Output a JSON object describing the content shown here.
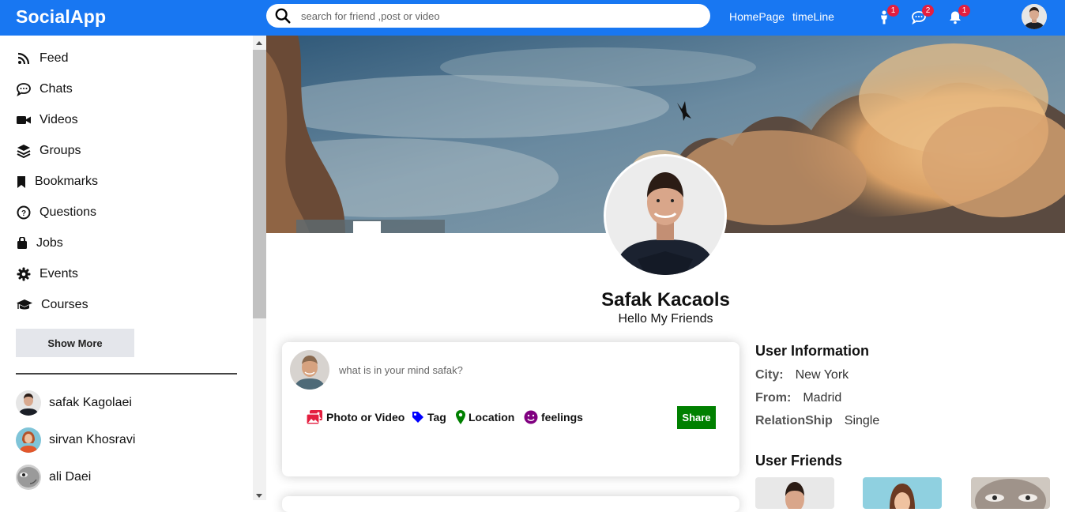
{
  "app": {
    "name": "SocialApp"
  },
  "search": {
    "placeholder": "search for friend ,post or video"
  },
  "nav": {
    "links": [
      "HomePage",
      "timeLine"
    ]
  },
  "notifications": {
    "friend_requests": "1",
    "messages": "2",
    "alerts": "1"
  },
  "sidebar": {
    "items": [
      {
        "label": "Feed",
        "icon": "rss-icon"
      },
      {
        "label": "Chats",
        "icon": "chat-icon"
      },
      {
        "label": "Videos",
        "icon": "video-icon"
      },
      {
        "label": "Groups",
        "icon": "layers-icon"
      },
      {
        "label": "Bookmarks",
        "icon": "bookmark-icon"
      },
      {
        "label": "Questions",
        "icon": "question-icon"
      },
      {
        "label": "Jobs",
        "icon": "briefcase-icon"
      },
      {
        "label": "Events",
        "icon": "gear-icon"
      },
      {
        "label": "Courses",
        "icon": "graduation-cap-icon"
      }
    ],
    "show_more": "Show More",
    "friends": [
      {
        "name": "safak Kagolaei"
      },
      {
        "name": "sirvan Khosravi"
      },
      {
        "name": "ali Daei"
      }
    ]
  },
  "profile": {
    "name": "Safak Kacaols",
    "description": "Hello My Friends"
  },
  "share": {
    "placeholder": "what is in your mind safak?",
    "options": [
      "Photo or Video",
      "Tag",
      "Location",
      "feelings"
    ],
    "button": "Share"
  },
  "user_info": {
    "title": "User Information",
    "rows": [
      {
        "key": "City:",
        "value": "New York"
      },
      {
        "key": "From:",
        "value": "Madrid"
      },
      {
        "key": "RelationShip",
        "value": "Single"
      }
    ],
    "friends_title": "User Friends"
  },
  "colors": {
    "brand": "#1877f2",
    "badge": "#e41e3f",
    "share_button": "#008000",
    "photo": "#e41e3f",
    "tag": "#0000ff",
    "location": "#008000",
    "feelings": "#800080"
  }
}
